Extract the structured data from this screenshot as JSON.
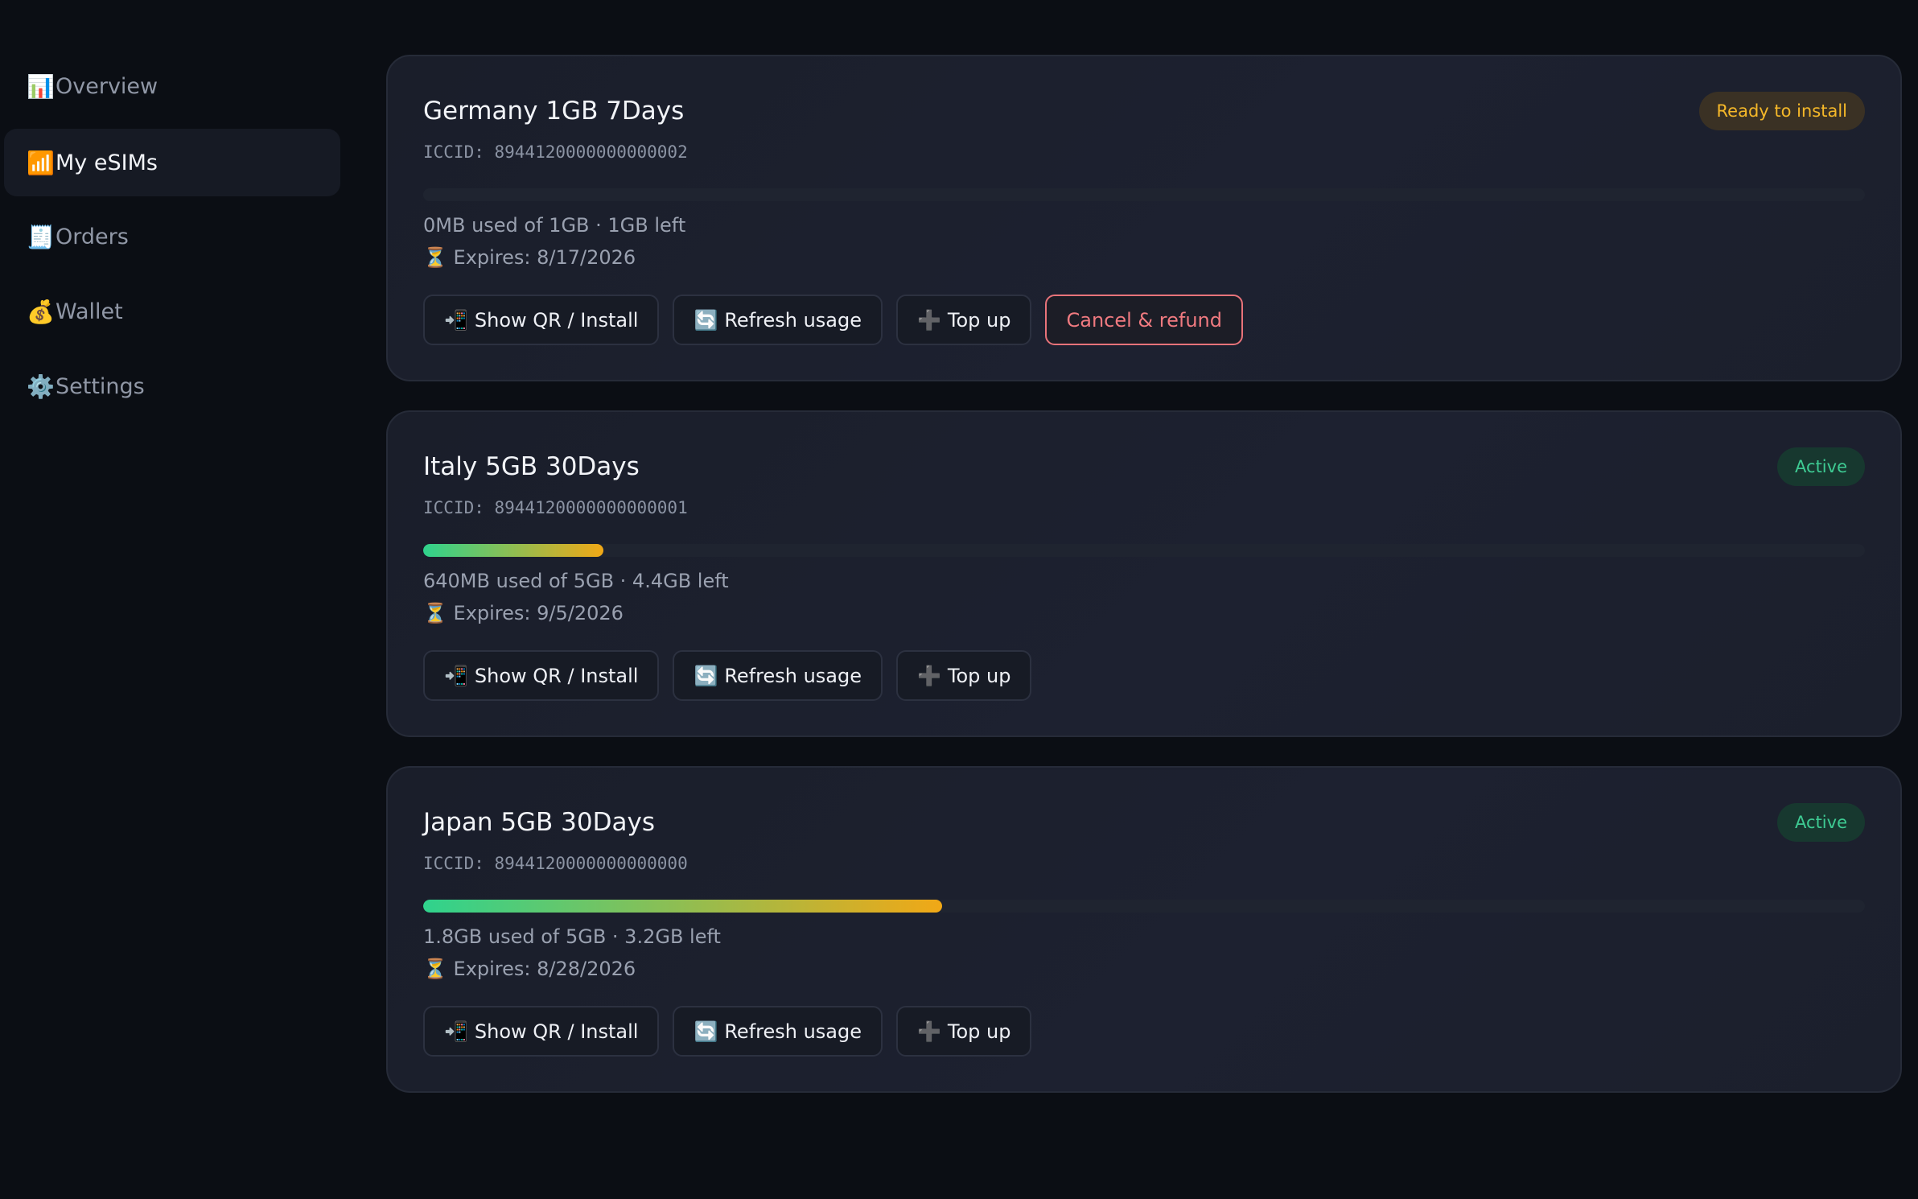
{
  "sidebar": {
    "items": [
      {
        "icon": "📊",
        "icon_name": "chart-icon",
        "label": "Overview",
        "active": false
      },
      {
        "icon": "📶",
        "icon_name": "signal-icon",
        "label": "My eSIMs",
        "active": true
      },
      {
        "icon": "🧾",
        "icon_name": "receipt-icon",
        "label": "Orders",
        "active": false
      },
      {
        "icon": "💰",
        "icon_name": "money-bag-icon",
        "label": "Wallet",
        "active": false
      },
      {
        "icon": "⚙️",
        "icon_name": "gear-icon",
        "label": "Settings",
        "active": false
      }
    ]
  },
  "esims": [
    {
      "title": "Germany 1GB 7Days",
      "iccid": "ICCID: 8944120000000000002",
      "status": "Ready to install",
      "status_kind": "ready",
      "usage_fraction": 0.0,
      "usage_text": "0MB used of 1GB · 1GB left",
      "expiry_icon": "⏳",
      "expiry_text": "Expires: 8/17/2026",
      "actions": [
        {
          "icon": "📲",
          "label": "Show QR / Install"
        },
        {
          "icon": "🔄",
          "label": "Refresh usage"
        },
        {
          "icon": "➕",
          "label": "Top up"
        },
        {
          "icon": "",
          "label": "Cancel & refund"
        }
      ]
    },
    {
      "title": "Italy 5GB 30Days",
      "iccid": "ICCID: 8944120000000000001",
      "status": "Active",
      "status_kind": "active",
      "usage_fraction": 0.125,
      "usage_text": "640MB used of 5GB · 4.4GB left",
      "expiry_icon": "⏳",
      "expiry_text": "Expires: 9/5/2026",
      "actions": [
        {
          "icon": "📲",
          "label": "Show QR / Install"
        },
        {
          "icon": "🔄",
          "label": "Refresh usage"
        },
        {
          "icon": "➕",
          "label": "Top up"
        }
      ]
    },
    {
      "title": "Japan 5GB 30Days",
      "iccid": "ICCID: 8944120000000000000",
      "status": "Active",
      "status_kind": "active",
      "usage_fraction": 0.36,
      "usage_text": "1.8GB used of 5GB · 3.2GB left",
      "expiry_icon": "⏳",
      "expiry_text": "Expires: 8/28/2026",
      "actions": [
        {
          "icon": "📲",
          "label": "Show QR / Install"
        },
        {
          "icon": "🔄",
          "label": "Refresh usage"
        },
        {
          "icon": "➕",
          "label": "Top up"
        }
      ]
    }
  ],
  "colors": {
    "background": "#0b0e14",
    "card": "#1b1f2c",
    "ready_badge_text": "#f5b829",
    "active_badge_text": "#3ecb93",
    "danger": "#f07a80",
    "progress_start": "#2fd38d",
    "progress_end": "#f1a816"
  }
}
